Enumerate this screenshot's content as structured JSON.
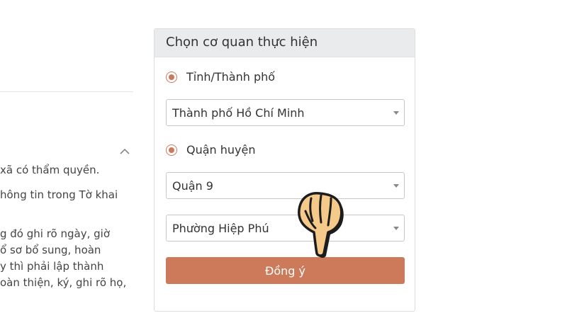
{
  "left_text": {
    "lines": [
      "xã có thẩm quyền.",
      "hông tin trong Tờ khai",
      "g đó ghi rõ ngày, giờ",
      "ổ sơ bổ sung, hoàn",
      "y thì phải lập thành",
      "oàn thiện, ký, ghi rõ họ,"
    ]
  },
  "agency_form": {
    "title": "Chọn cơ quan thực hiện",
    "options": {
      "province": "Tỉnh/Thành phố",
      "district": "Quận huyện"
    },
    "selects": {
      "province": "Thành phố Hồ Chí Minh",
      "district": "Quận 9",
      "ward": "Phường Hiệp Phú"
    },
    "submit_label": "Đồng ý"
  },
  "colors": {
    "accent": "#cc7a5a",
    "header_bg": "#e9ebed"
  },
  "icons": {
    "pointer": "pointing-hand-icon",
    "collapse": "chevron-up-icon",
    "dropdown": "caret-down-icon"
  }
}
